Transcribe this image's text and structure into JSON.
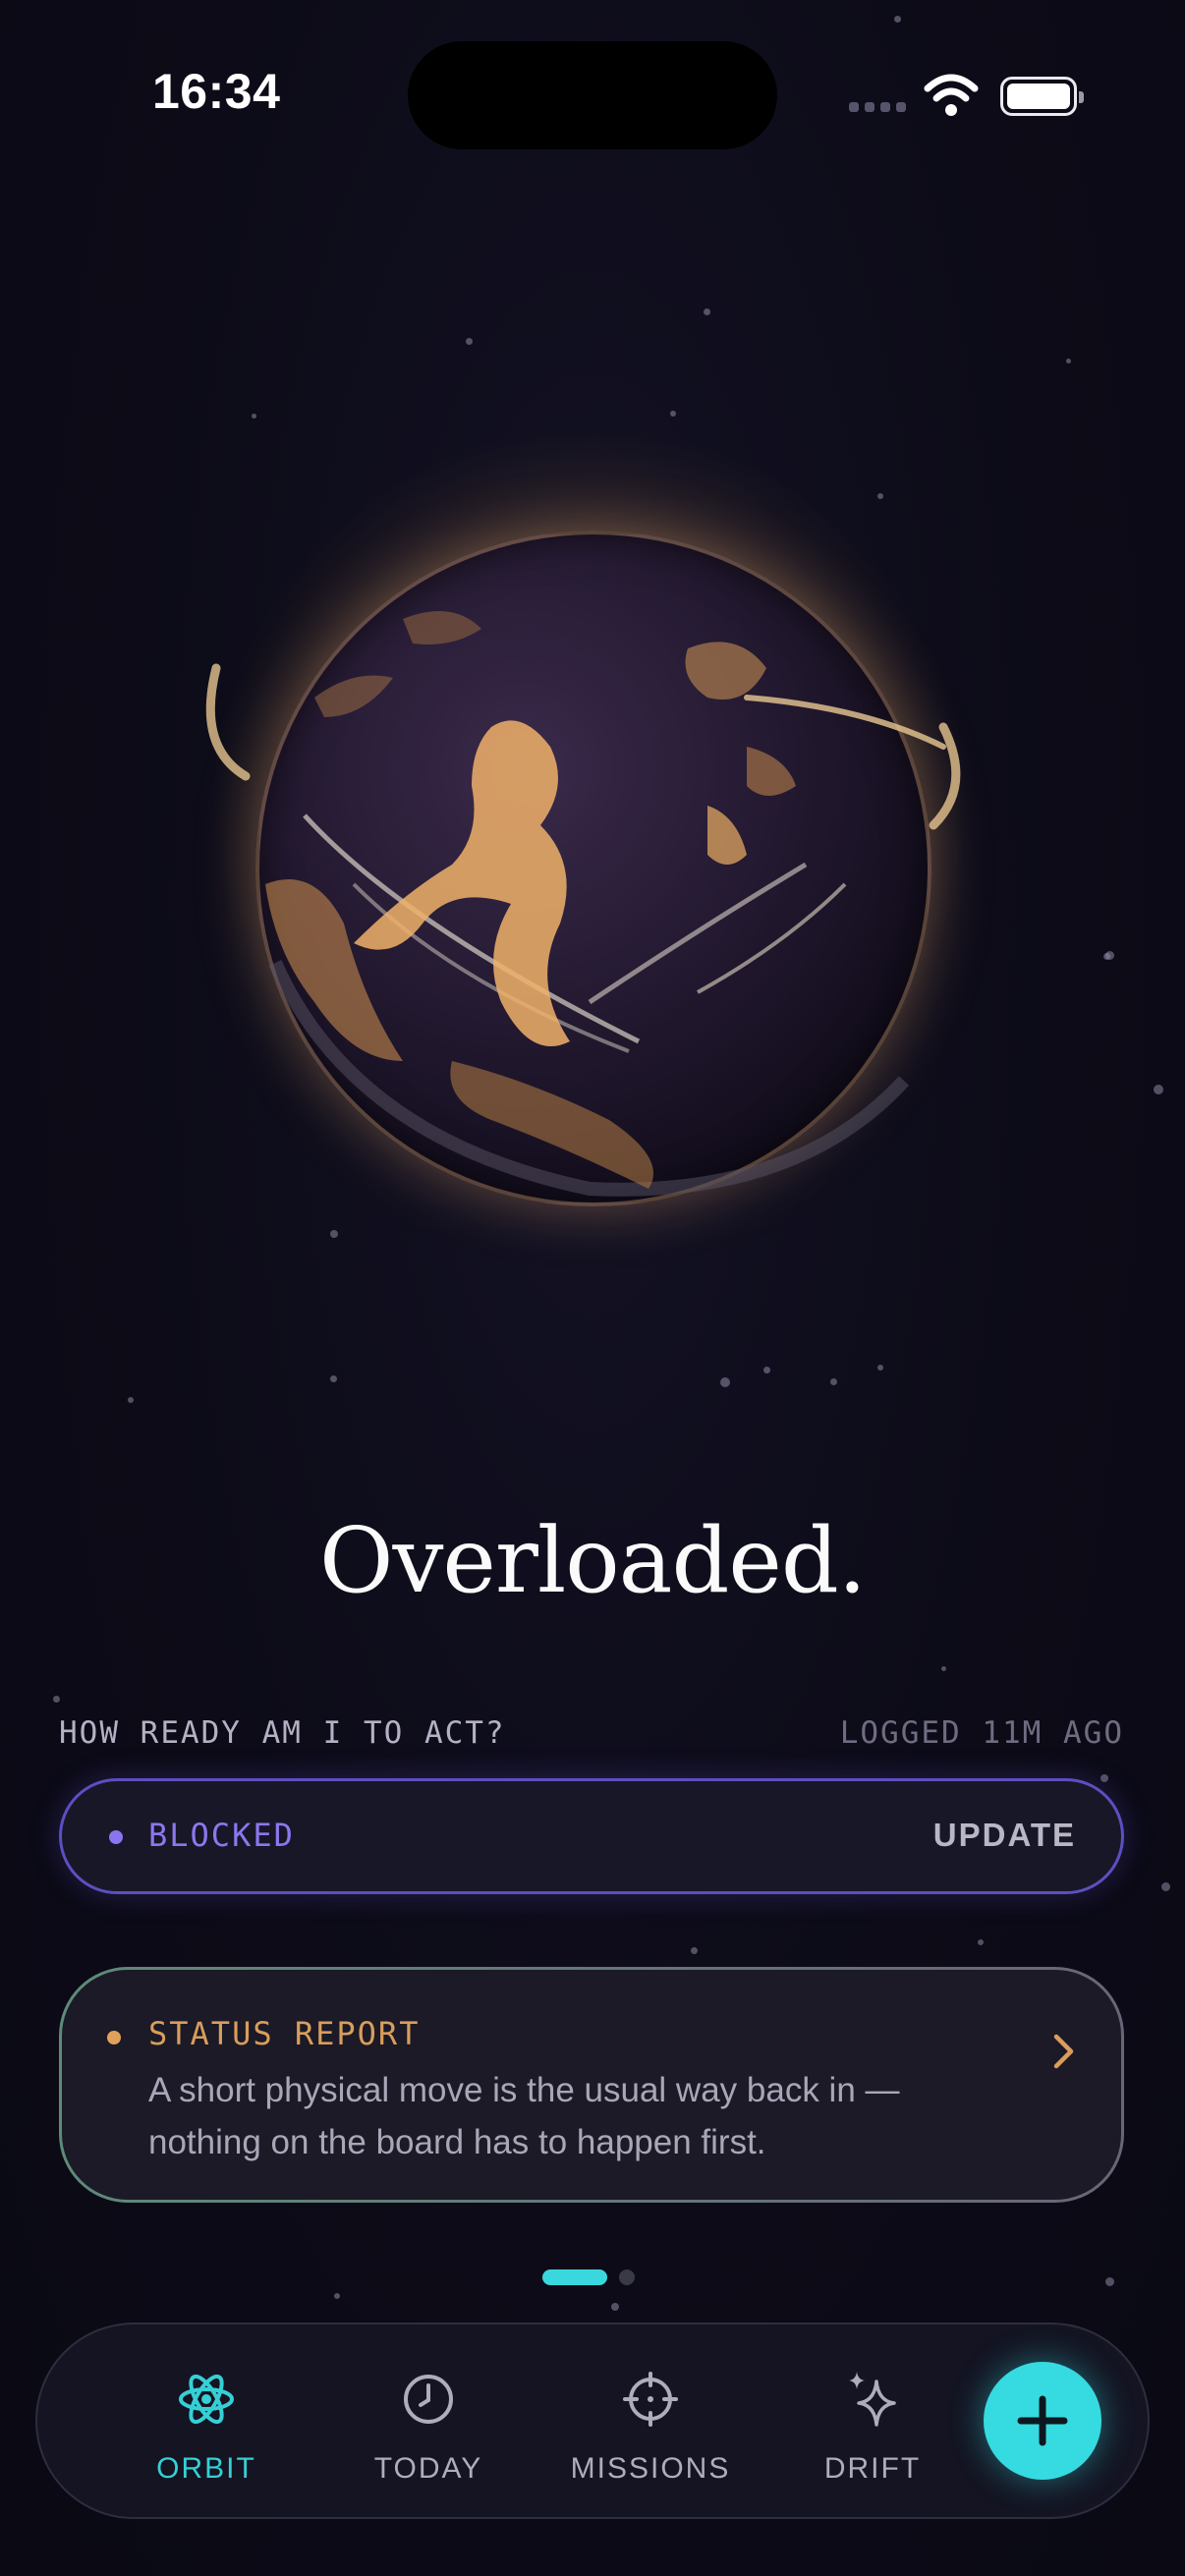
{
  "status_bar": {
    "time": "16:34"
  },
  "headline": "Overloaded.",
  "readiness": {
    "question": "HOW READY AM I TO ACT?",
    "logged": "LOGGED 11M AGO",
    "state": "BLOCKED",
    "update_label": "UPDATE",
    "accent_color": "#8a74f0"
  },
  "status_report": {
    "title": "STATUS REPORT",
    "body": "A short physical move is the usual way back in — nothing on the board has to happen first.",
    "accent_color": "#e0a25b"
  },
  "pager": {
    "pages": 2,
    "current": 1
  },
  "tabs": [
    {
      "label": "ORBIT",
      "icon": "atom-icon",
      "active": true
    },
    {
      "label": "TODAY",
      "icon": "clock-icon",
      "active": false
    },
    {
      "label": "MISSIONS",
      "icon": "crosshair-icon",
      "active": false
    },
    {
      "label": "DRIFT",
      "icon": "sparkle-icon",
      "active": false
    }
  ],
  "fab": {
    "icon": "plus-icon",
    "color": "#35dbe0"
  }
}
